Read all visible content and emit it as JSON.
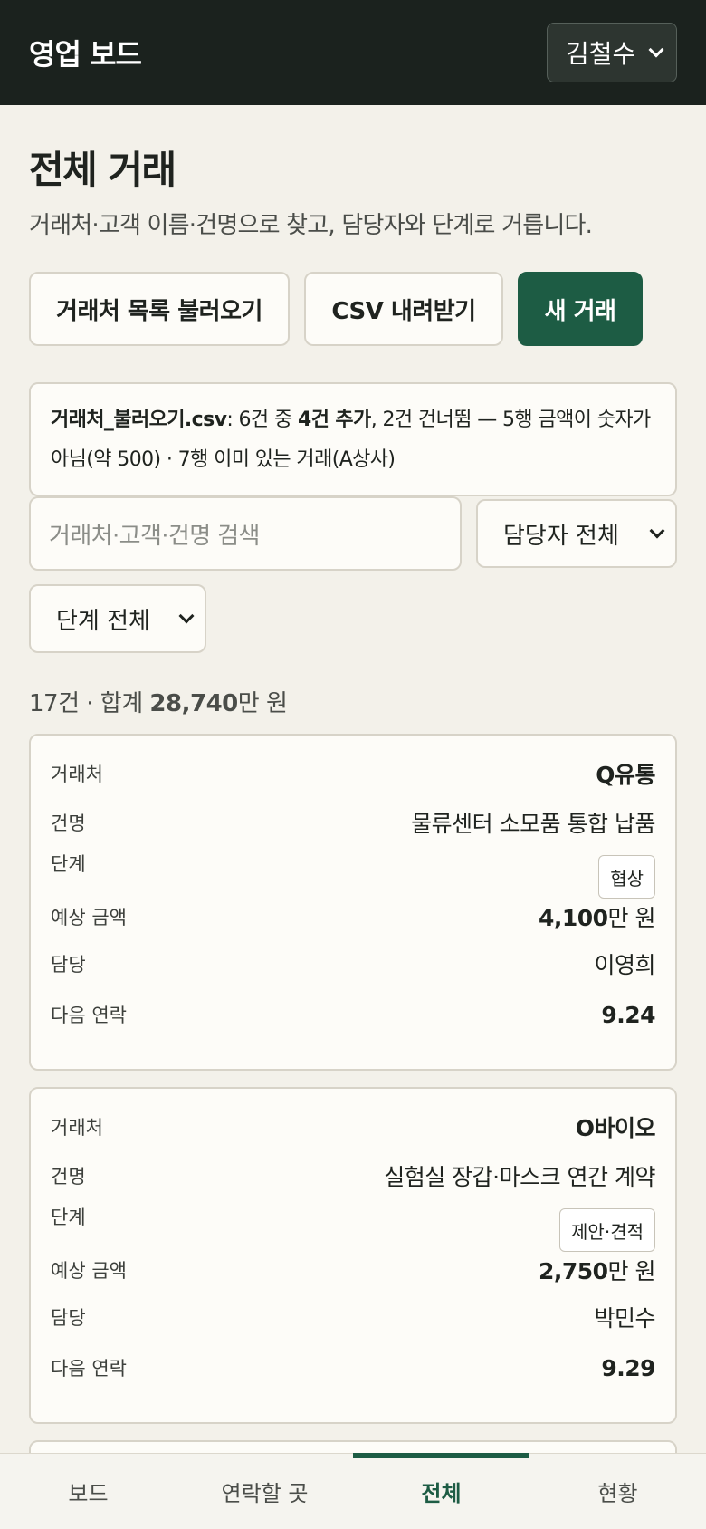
{
  "header": {
    "app_title": "영업 보드",
    "user": "김철수",
    "accent": "#1d5c44"
  },
  "page": {
    "title": "전체 거래",
    "description": "거래처·고객 이름·건명으로 찾고, 담당자와 단계로 거릅니다."
  },
  "actions": {
    "import_label": "거래처 목록 불러오기",
    "csv_label": "CSV 내려받기",
    "new_label": "새 거래"
  },
  "notice": {
    "filename": "거래처_불러오기.csv",
    "text1": ": 6건 중 ",
    "added": "4건 추가",
    "text2": ", 2건 건너뜀 — 5행 금액이 숫자가 아님(약 500) · 7행 이미 있는 거래(A상사)"
  },
  "filters": {
    "search_placeholder": "거래처·고객·건명 검색",
    "owner_selected": "담당자 전체",
    "stage_selected": "단계 전체"
  },
  "summary": {
    "count": "17건",
    "sep": " · 합계 ",
    "total": "28,740",
    "unit": "만 원"
  },
  "labels": {
    "client": "거래처",
    "title": "건명",
    "stage": "단계",
    "amount": "예상 금액",
    "owner": "담당",
    "next_contact": "다음 연락"
  },
  "deals": [
    {
      "client": "Q유통",
      "title": "물류센터 소모품 통합 납품",
      "stage": "협상",
      "amount": "4,100",
      "amount_unit": "만 원",
      "owner": "이영희",
      "next_contact": "9.24"
    },
    {
      "client": "O바이오",
      "title": "실험실 장갑·마스크 연간 계약",
      "stage": "제안·견적",
      "amount": "2,750",
      "amount_unit": "만 원",
      "owner": "박민수",
      "next_contact": "9.29"
    }
  ],
  "tabs": [
    {
      "label": "보드"
    },
    {
      "label": "연락할 곳"
    },
    {
      "label": "전체"
    },
    {
      "label": "현황"
    }
  ]
}
